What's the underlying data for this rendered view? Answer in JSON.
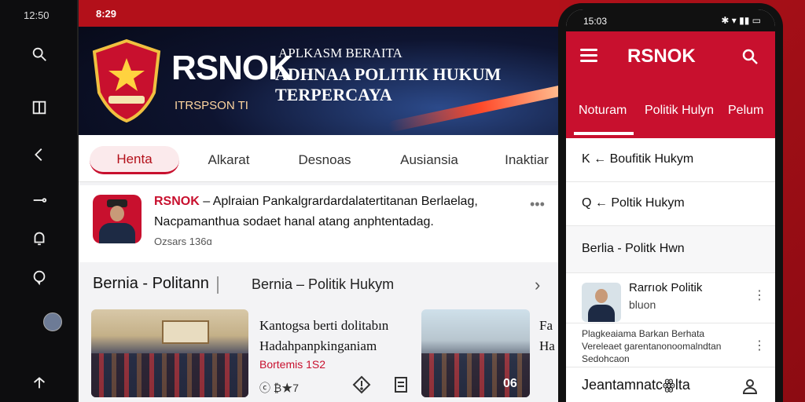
{
  "rail": {
    "clock": "12:50",
    "icons": [
      "search-icon",
      "layout-icon",
      "back-icon",
      "key-icon",
      "bell-icon",
      "chat-icon",
      "profile-avatar",
      "share-icon"
    ]
  },
  "banner": {
    "status_time": "8:29",
    "brand": "RSNOK",
    "tagline_1": "APLKASM BERAITA",
    "tagline_2": "ADHNAA POLITIK HUKUM TERPERCAYA",
    "sponsor": "ITRSPSON TI",
    "colors": {
      "accent": "#c8102e",
      "dark": "#0e1430"
    }
  },
  "tabs": [
    "Henta",
    "Alkarat",
    "Desnoas",
    "Ausiansia",
    "Inaktiar"
  ],
  "post": {
    "source": "RSNOK",
    "line1_rest": " – Aplraian Pankalgrardardalatertitanan Berlaelag,",
    "line2": "Nacpamanthua sodaet hanal atang anphtentadag.",
    "meta": "Ozsars 136ɑ",
    "more": "•••"
  },
  "section": {
    "title": "Bernia - Politann",
    "subtitle": "Bernia – Politik Hukym",
    "chevron": "›"
  },
  "article": {
    "title_line1": "Kantogsa berti dolitabın",
    "title_line2": "Hadahpanpkinganiam",
    "date": "Bortemis 1S2",
    "stats": "ⓒ ₿★7",
    "badge": "06",
    "side_text": "Fa\nHa"
  },
  "phone": {
    "time": "15:03",
    "status_icons": "✱ ▾ ▮▮ ▭",
    "title": "RSNOK",
    "tabs": [
      "Notuɾam",
      "Politik Hulyn",
      "Pelum"
    ],
    "rows": [
      "K ← Boufitik Hukym",
      "Q ← Poltik Hukym",
      "Berlia - Politk Hwn"
    ],
    "profile": {
      "name_line1": "Rarrıok Politik",
      "name_line2": "bluon"
    },
    "desc": {
      "line1": "Plagkeaiama Barkan Berhata",
      "line2": "Vereleaet garentanonoomalndtan",
      "line3": "Sedohcaon"
    },
    "bottom_label": "Jeantamnatcꙮlta",
    "kebab": "⋮"
  }
}
